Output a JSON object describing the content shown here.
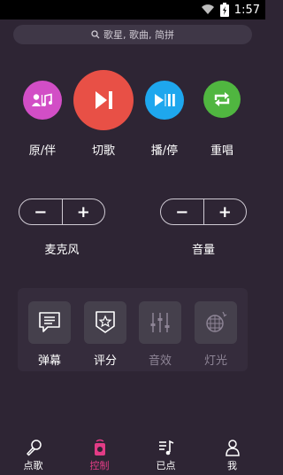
{
  "status": {
    "time": "1:57"
  },
  "search": {
    "placeholder": "歌星, 歌曲, 简拼"
  },
  "controls": {
    "original": {
      "label": "原/伴",
      "color": "#d24ec6"
    },
    "skip": {
      "label": "切歌",
      "color": "#e85046"
    },
    "playpause": {
      "label": "播/停",
      "color": "#1ea7ee"
    },
    "repeat": {
      "label": "重唱",
      "color": "#50b640"
    }
  },
  "mic": {
    "label": "麦克风",
    "minus": "−",
    "plus": "+"
  },
  "volume": {
    "label": "音量",
    "minus": "−",
    "plus": "+"
  },
  "effects": [
    {
      "label": "弹幕",
      "enabled": true
    },
    {
      "label": "评分",
      "enabled": true
    },
    {
      "label": "音效",
      "enabled": false
    },
    {
      "label": "灯光",
      "enabled": false
    }
  ],
  "tabs": [
    {
      "label": "点歌"
    },
    {
      "label": "控制"
    },
    {
      "label": "已点"
    },
    {
      "label": "我"
    }
  ],
  "colors": {
    "active": "#e23c86",
    "disabled": "#8e8596"
  }
}
